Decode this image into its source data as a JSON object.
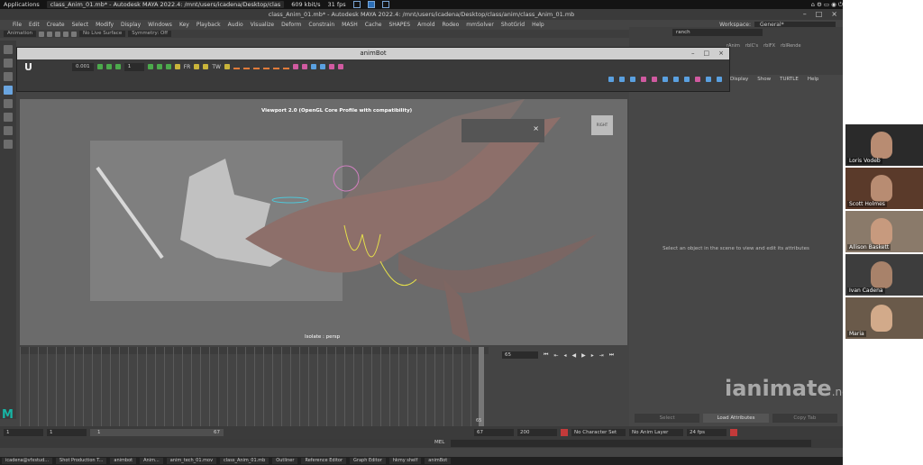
{
  "sysbar": {
    "apps": "Applications",
    "task": "class_Anim_01.mb* - Autodesk MAYA 2022.4: /mnt/users/icadena/Desktop/clas",
    "bitrate": "609 kbit/s",
    "fps": "31 fps"
  },
  "maya": {
    "title": "class_Anim_01.mb* - Autodesk MAYA 2022.4: /mnt/users/icadena/Desktop/class/anim/class_Anim_01.mb",
    "menus": [
      "File",
      "Edit",
      "Create",
      "Select",
      "Modify",
      "Display",
      "Windows",
      "Key",
      "Playback",
      "Audio",
      "Visualize",
      "Deform",
      "Constrain",
      "MASH",
      "Cache",
      "SHAPES",
      "Arnold",
      "Rodeo",
      "mmSolver",
      "ShotGrid",
      "Help"
    ],
    "workspace_label": "Workspace:",
    "workspace_value": "General*",
    "shelf_mode": "Animation",
    "live_surface": "No Live Surface",
    "symmetry": "Symmetry: Off",
    "channel_field": "ranch",
    "channel_tabs": [
      "rAnim",
      "rbIC's",
      "rbIFX",
      "rbIRende"
    ]
  },
  "animbot": {
    "title": "animBot",
    "logo": "U",
    "value1": "0.001",
    "value2": "1",
    "label_fr": "FR",
    "label_tw": "TW"
  },
  "viewport": {
    "label": "Viewport 2.0 (OpenGL Core Profile with compatibility)",
    "isolate": "Isolate : persp",
    "cube": "RIGHT"
  },
  "attr": {
    "tabs": [
      "Display",
      "Show",
      "TURTLE",
      "Help"
    ],
    "message": "Select an object in the scene to view and edit its attributes",
    "buttons": [
      "Select",
      "Load Attributes",
      "Copy Tab"
    ]
  },
  "timeline": {
    "current_frame": "65",
    "end_label": "65"
  },
  "range": {
    "start": "1",
    "start2": "1",
    "slider_start": "1",
    "slider_end": "67",
    "end": "67",
    "end2": "200",
    "charset": "No Character Set",
    "animlayer": "No Anim Layer",
    "fps": "24 fps"
  },
  "cmd": {
    "mel": "MEL"
  },
  "branding": {
    "ianimate": "ianimate",
    "net": ".net"
  },
  "taskbar": [
    "icadena@vfxstud...",
    "Shot Production T...",
    "animbot",
    "Anim...",
    "anim_tech_01.mov",
    "class_Anim_01.mb",
    "Outliner",
    "Reference Editor",
    "Graph Editor",
    "hkmy shelf",
    "animBot"
  ],
  "participants": [
    {
      "name": "Loris Vodeb"
    },
    {
      "name": "Scott Holmes"
    },
    {
      "name": "Allison Baskett"
    },
    {
      "name": "Ivan Cadena"
    },
    {
      "name": "Maria"
    }
  ],
  "colors": {
    "accent": "#2c6fb7",
    "maya_teal": "#17b5a5",
    "rig_yellow": "#e5e04a",
    "rig_cyan": "#4fc6d8"
  }
}
